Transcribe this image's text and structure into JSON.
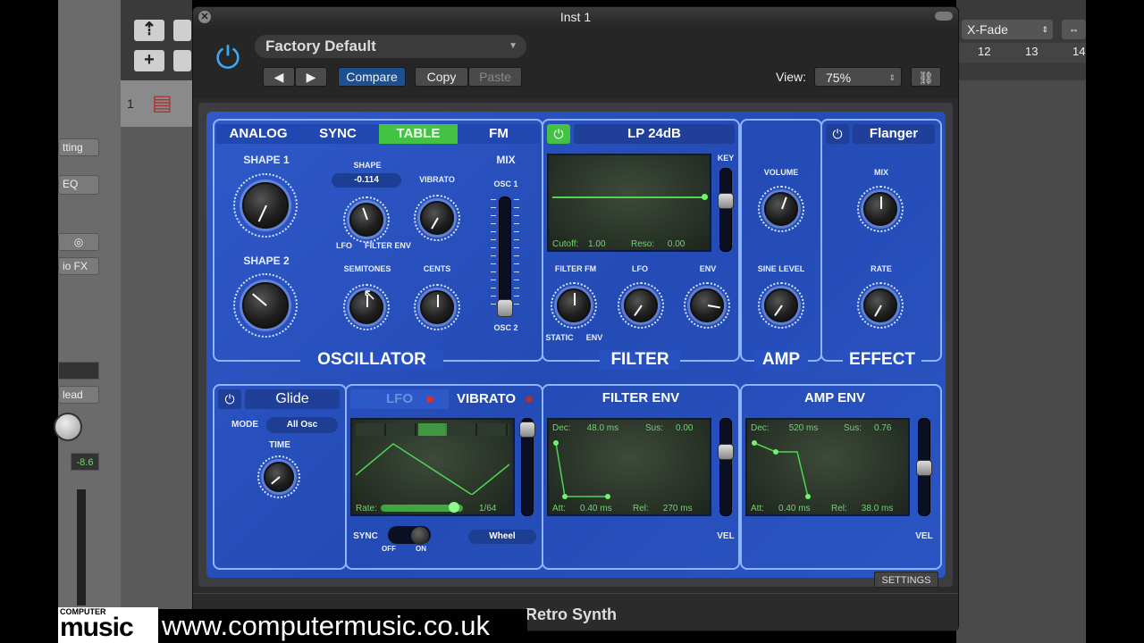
{
  "window": {
    "title": "Inst 1",
    "plugin_name": "Retro Synth"
  },
  "header": {
    "preset": "Factory Default",
    "prev_label": "◀",
    "next_label": "▶",
    "compare_label": "Compare",
    "copy_label": "Copy",
    "paste_label": "Paste",
    "view_label": "View:",
    "view_value": "75%"
  },
  "daw": {
    "crossfade_label": "X-Fade",
    "ruler": [
      "12",
      "13",
      "14"
    ],
    "track_number": "1",
    "sidebar_labels": [
      "tting",
      "EQ",
      "io FX",
      "lead"
    ],
    "volume_value": "-8.6"
  },
  "oscillator": {
    "tabs": [
      "ANALOG",
      "SYNC",
      "TABLE",
      "FM"
    ],
    "active_tab": "TABLE",
    "shape1_label": "SHAPE 1",
    "shape2_label": "SHAPE 2",
    "shape_label": "SHAPE",
    "shape_value": "-0.114",
    "vibrato_label": "VIBRATO",
    "lfo_label": "LFO",
    "filter_env_label": "FILTER ENV",
    "semitones_label": "SEMITONES",
    "cents_label": "CENTS",
    "mix_label": "MIX",
    "osc1_label": "OSC 1",
    "osc2_label": "OSC 2",
    "title": "OSCILLATOR"
  },
  "filter": {
    "type": "LP 24dB",
    "key_label": "KEY",
    "cutoff_text": "Cutoff:",
    "cutoff_value": "1.00",
    "reso_text": "Reso:",
    "reso_value": "0.00",
    "filter_fm_label": "FILTER FM",
    "lfo_label": "LFO",
    "env_label": "ENV",
    "static_label": "STATIC",
    "env_sub_label": "ENV",
    "title": "FILTER"
  },
  "amp": {
    "volume_label": "VOLUME",
    "sine_level_label": "SINE LEVEL",
    "title": "AMP"
  },
  "effect": {
    "type": "Flanger",
    "mix_label": "MIX",
    "rate_label": "RATE",
    "title": "EFFECT"
  },
  "glide": {
    "label": "Glide",
    "mode_label": "MODE",
    "mode_value": "All Osc",
    "time_label": "TIME"
  },
  "lfo": {
    "lfo_label": "LFO",
    "vibrato_label": "VIBRATO",
    "rate_text": "Rate:",
    "rate_value": "1/64",
    "sync_label": "SYNC",
    "off_label": "OFF",
    "on_label": "ON",
    "wheel_label": "Wheel"
  },
  "filter_env": {
    "title": "FILTER ENV",
    "dec_text": "Dec:",
    "dec_value": "48.0 ms",
    "sus_text": "Sus:",
    "sus_value": "0.00",
    "att_text": "Att:",
    "att_value": "0.40 ms",
    "rel_text": "Rel:",
    "rel_value": "270 ms"
  },
  "amp_env": {
    "title": "AMP ENV",
    "dec_text": "Dec:",
    "dec_value": "520 ms",
    "sus_text": "Sus:",
    "sus_value": "0.76",
    "att_text": "Att:",
    "att_value": "0.40 ms",
    "rel_text": "Rel:",
    "rel_value": "38.0 ms"
  },
  "vel_label": "VEL",
  "settings_label": "SETTINGS",
  "watermark": {
    "logo_top": "COMPUTER",
    "logo_main": "music",
    "url": "www.computermusic.co.uk"
  },
  "colors": {
    "panel_blue": "#2a55c4",
    "active_green": "#43c243",
    "screen_green": "#6fd46f",
    "power_blue": "#3fa9f5"
  }
}
